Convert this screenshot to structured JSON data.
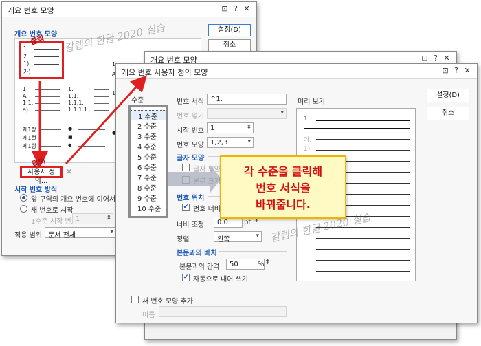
{
  "back_dialog": {
    "title": "개요 번호 모양",
    "ok_label": "설정(D)",
    "cancel_label": "취소",
    "section_label": "개요 번호 모양",
    "custom_button_label": "사용자 정의...",
    "start_section_label": "시작 번호 방식",
    "radio_continue_label": "앞 구역의 개요 번호에 이어서",
    "radio_new_label": "새 번호로 시작",
    "level1_start_label": "1수준 시작 번호",
    "level1_start_value": "1",
    "apply_label": "적용 범위",
    "apply_value": "문서 전체",
    "preset1_nums": [
      "1.",
      "가.",
      "1)",
      "가)"
    ],
    "preset2_nums": [
      "1.",
      "A.",
      "1.1.",
      "1.1.1.",
      "a)"
    ],
    "preset3_nums": [
      "1.",
      "1.1.",
      "1.1.1.",
      "1.1.1.1."
    ],
    "preset4_nums": [
      "제1장",
      "제1절",
      "제1항"
    ],
    "bullet_glyphs": [
      "●",
      "■",
      "◆"
    ]
  },
  "middle_dialog": {
    "title": "개요 번호 모양"
  },
  "custom_dialog": {
    "title": "개요 번호 사용자 정의 모양",
    "ok_label": "설정(D)",
    "cancel_label": "취소",
    "level_label": "수준",
    "levels": [
      "1 수준",
      "2 수준",
      "3 수준",
      "4 수준",
      "5 수준",
      "6 수준",
      "7 수준",
      "8 수준",
      "9 수준",
      "10 수준"
    ],
    "format_label": "번호 서식",
    "format_value": "^1.",
    "insert_label": "번호 넣기",
    "start_label": "시작 번호",
    "start_value": "1",
    "shape_label": "번호 모양",
    "shape_value": "1,2,3",
    "char_section": "글자 모양",
    "char_check_label": "글자 모양 지정",
    "char_check2_label": "본문 크기에 맞춤",
    "pos_section": "번호 위치",
    "width_check_label": "번호 너비를 자릿수에",
    "width_adjust_label": "너비 조정",
    "width_value": "0.0",
    "width_unit": "pt",
    "align_label": "정렬",
    "align_value": "왼쪽",
    "body_section": "본문과의 배치",
    "spacing_label": "본문과의 간격",
    "spacing_value": "50",
    "spacing_unit": "%",
    "auto_indent_label": "자동으로 내어 쓰기",
    "preview_label": "미리 보기",
    "preview_nums": [
      "1.",
      "가.",
      "1)"
    ],
    "add_shape_label": "새 번호 모양 추가",
    "name_label": "이름"
  },
  "annotations": {
    "click_label_1": "클릭",
    "click_label_2": "클릭",
    "callout_line1": "각 수준을 클릭해",
    "callout_line2": "번호 서식을",
    "callout_line3": "바꿔줍니다.",
    "watermark_1": "갈렙의 한글 2020 실습",
    "watermark_2": "갈렙의 한글 2020 실습"
  },
  "colors": {
    "callout_bg": "#fff9c4",
    "callout_border": "#f0b400",
    "callout_text": "#d11010",
    "highlight_red": "#e02020",
    "accent_blue": "#1a56b8"
  }
}
